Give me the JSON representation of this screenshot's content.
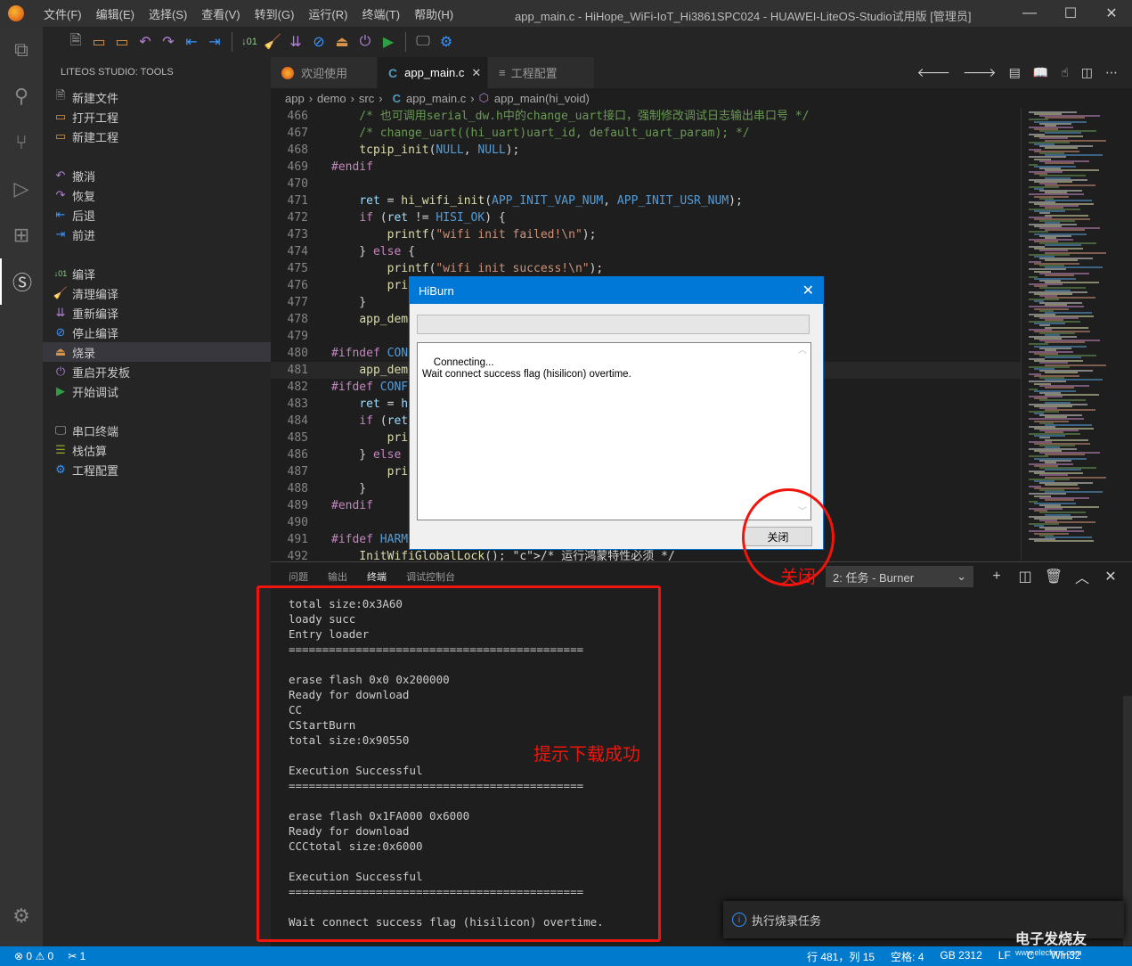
{
  "window": {
    "title": "app_main.c - HiHope_WiFi-IoT_Hi3861SPC024 - HUAWEI-LiteOS-Studio试用版 [管理员]",
    "menu": [
      "文件(F)",
      "编辑(E)",
      "选择(S)",
      "查看(V)",
      "转到(G)",
      "运行(R)",
      "终端(T)",
      "帮助(H)"
    ],
    "controls": {
      "minimize": "—",
      "maximize": "☐",
      "close": "✕"
    }
  },
  "toolbar": {
    "icons": [
      "new-file",
      "open-project",
      "new-project",
      "undo",
      "redo",
      "back",
      "forward",
      "build",
      "clean-build",
      "rebuild",
      "stop-build",
      "burn",
      "reset-board",
      "start-debug",
      "serial-terminal",
      "project-config"
    ]
  },
  "sidebar": {
    "title": "LITEOS STUDIO: TOOLS",
    "groups": [
      [
        {
          "label": "新建文件",
          "icon": "new-file"
        },
        {
          "label": "打开工程",
          "icon": "open-project"
        },
        {
          "label": "新建工程",
          "icon": "new-project"
        }
      ],
      [
        {
          "label": "撤消",
          "icon": "undo"
        },
        {
          "label": "恢复",
          "icon": "redo"
        },
        {
          "label": "后退",
          "icon": "back"
        },
        {
          "label": "前进",
          "icon": "forward"
        }
      ],
      [
        {
          "label": "编译",
          "icon": "build"
        },
        {
          "label": "清理编译",
          "icon": "clean"
        },
        {
          "label": "重新编译",
          "icon": "rebuild"
        },
        {
          "label": "停止编译",
          "icon": "stop"
        },
        {
          "label": "烧录",
          "icon": "burn",
          "selected": true
        },
        {
          "label": "重启开发板",
          "icon": "power"
        },
        {
          "label": "开始调试",
          "icon": "play"
        }
      ],
      [
        {
          "label": "串口终端",
          "icon": "serial"
        },
        {
          "label": "栈估算",
          "icon": "stack"
        },
        {
          "label": "工程配置",
          "icon": "gears"
        }
      ]
    ]
  },
  "tabs": [
    {
      "label": "欢迎使用",
      "icon": "liteos-logo"
    },
    {
      "label": "app_main.c",
      "icon": "c-file",
      "active": true
    },
    {
      "label": "工程配置",
      "icon": "list"
    }
  ],
  "breadcrumb": [
    "app",
    "demo",
    "src",
    "app_main.c",
    "app_main(hi_void)"
  ],
  "editor": {
    "lines": [
      {
        "n": "466",
        "t": "    /* 也可调用serial_dw.h中的change_uart接口，强制修改调试日志输出串口号 */"
      },
      {
        "n": "467",
        "t": "    /* change_uart((hi_uart)uart_id, default_uart_param); */"
      },
      {
        "n": "468",
        "t": "    tcpip_init(NULL, NULL);"
      },
      {
        "n": "469",
        "t": "#endif"
      },
      {
        "n": "470",
        "t": ""
      },
      {
        "n": "471",
        "t": "    ret = hi_wifi_init(APP_INIT_VAP_NUM, APP_INIT_USR_NUM);"
      },
      {
        "n": "472",
        "t": "    if (ret != HISI_OK) {"
      },
      {
        "n": "473",
        "t": "        printf(\"wifi init failed!\\n\");"
      },
      {
        "n": "474",
        "t": "    } else {"
      },
      {
        "n": "475",
        "t": "        printf(\"wifi init success!\\n\");"
      },
      {
        "n": "476",
        "t": "        pri"
      },
      {
        "n": "477",
        "t": "    }"
      },
      {
        "n": "478",
        "t": "    app_demo"
      },
      {
        "n": "479",
        "t": ""
      },
      {
        "n": "480",
        "t": "#ifndef CONF"
      },
      {
        "n": "481",
        "t": "    app_demo"
      },
      {
        "n": "482",
        "t": "#ifdef CONFI"
      },
      {
        "n": "483",
        "t": "    ret = hi"
      },
      {
        "n": "484",
        "t": "    if (ret"
      },
      {
        "n": "485",
        "t": "        pri"
      },
      {
        "n": "486",
        "t": "    } else {"
      },
      {
        "n": "487",
        "t": "        pri"
      },
      {
        "n": "488",
        "t": "    }"
      },
      {
        "n": "489",
        "t": "#endif"
      },
      {
        "n": "490",
        "t": ""
      },
      {
        "n": "491",
        "t": "#ifdef HARMO"
      },
      {
        "n": "492",
        "t": "    InitWifiGlobalLock(); /* 运行鸿蒙特性必须 */"
      }
    ]
  },
  "dialog": {
    "title": "HiBurn",
    "progress": 0,
    "log": "Connecting...\nWait connect success flag (hisilicon) overtime.",
    "close_button": "关闭"
  },
  "panel": {
    "tabs": [
      "问题",
      "输出",
      "终端",
      "调试控制台"
    ],
    "active_tab": "终端",
    "terminal_select": "2: 任务 - Burner",
    "terminal_output": "total size:0x3A60\nloady succ\nEntry loader\n============================================\n\nerase flash 0x0 0x200000\nReady for download\nCC\nCStartBurn\ntotal size:0x90550\n\nExecution Successful\n============================================\n\nerase flash 0x1FA000 0x6000\nReady for download\nCCCtotal size:0x6000\n\nExecution Successful\n============================================\n\nWait connect success flag (hisilicon) overtime."
  },
  "annotations": {
    "success_hint": "提示下载成功",
    "close_hint": "关闭",
    "color": "#f0140c"
  },
  "notification": {
    "text": "执行烧录任务"
  },
  "statusbar": {
    "errors": "0",
    "warnings": "0",
    "tasks": "1",
    "position": "行 481，列 15",
    "indent": "空格: 4",
    "encoding": "GB 2312",
    "eol": "LF",
    "language": "C",
    "platform": "Win32"
  },
  "watermark": {
    "name": "电子发烧友",
    "url": "www.elecfans.com"
  },
  "colors": {
    "accent": "#007acc",
    "dialog_title": "#0078d7"
  }
}
